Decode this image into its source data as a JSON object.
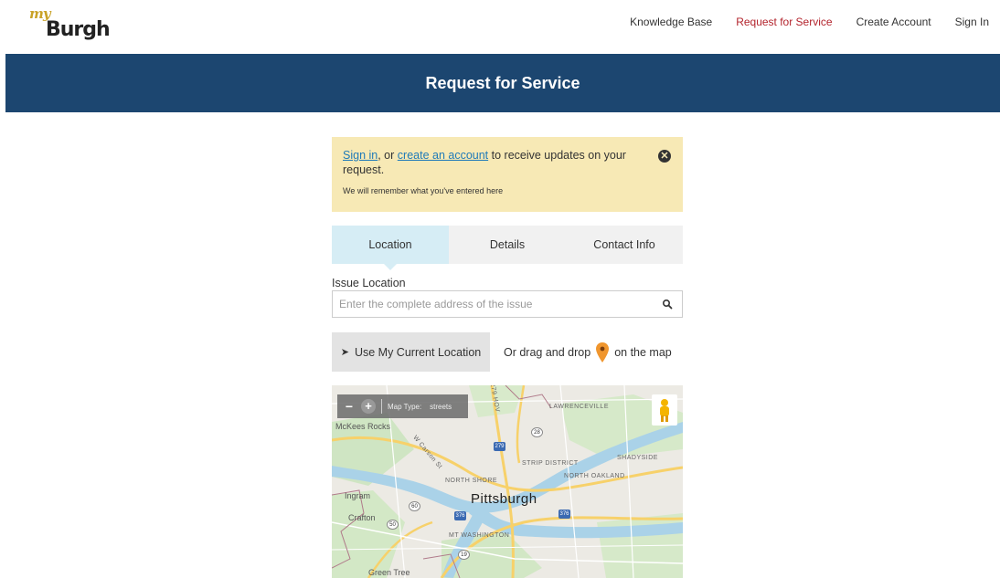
{
  "logo": {
    "my": "my",
    "burgh": "Burgh"
  },
  "nav": {
    "items": [
      {
        "label": "Knowledge Base"
      },
      {
        "label": "Request for Service"
      },
      {
        "label": "Create Account"
      },
      {
        "label": "Sign In"
      }
    ],
    "active_color": "#b3242d"
  },
  "banner": {
    "title": "Request for Service",
    "color": "#1c4670"
  },
  "notice": {
    "sign_in_link": "Sign in",
    "sep": ", or ",
    "create_link": "create an account",
    "rest": " to receive updates on your request.",
    "remember": "We will remember what you've entered here",
    "close_icon": "close-circle-icon"
  },
  "tabs": [
    {
      "label": "Location",
      "active": true
    },
    {
      "label": "Details",
      "active": false
    },
    {
      "label": "Contact Info",
      "active": false
    }
  ],
  "issue_location": {
    "label": "Issue Location",
    "placeholder": "Enter the complete address of the issue"
  },
  "use_location_button": "Use My Current Location",
  "drag_drop": {
    "before": "Or drag and drop",
    "after": "on the map"
  },
  "map": {
    "map_type_label": "Map Type:",
    "map_type_value": "streets",
    "zoom_out": "−",
    "zoom_in": "+",
    "labels": {
      "mckees_rocks": "McKees Rocks",
      "lawrenceville": "LAWRENCEVILLE",
      "shadyside": "SHADYSIDE",
      "strip_district": "STRIP DISTRICT",
      "north_oakland": "NORTH OAKLAND",
      "north_shore": "NORTH SHORE",
      "pittsburgh": "Pittsburgh",
      "ingram": "Ingram",
      "crafton": "Crafton",
      "mt_washington": "MT WASHINGTON",
      "green_tree": "Green Tree",
      "carson": "W Carson St",
      "route_279": "279",
      "route_28": "28",
      "route_376a": "376",
      "route_376b": "376",
      "route_60": "60",
      "route_50": "50",
      "route_19": "19",
      "route_279_top": "279 HOV"
    }
  }
}
